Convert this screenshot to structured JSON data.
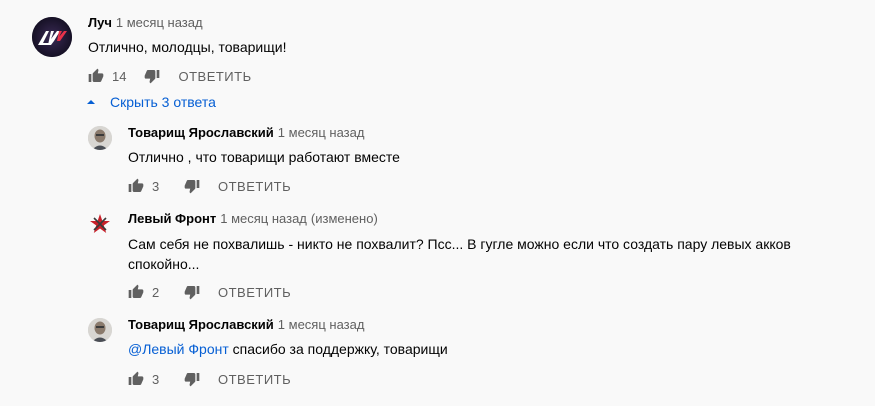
{
  "comments": [
    {
      "author": "Луч",
      "time": "1 месяц назад",
      "text": "Отлично, молодцы, товарищи!",
      "likes": "14",
      "reply_label": "ОТВЕТИТЬ"
    }
  ],
  "replies_toggle": {
    "label": "Скрыть 3 ответа"
  },
  "replies": [
    {
      "author": "Товарищ Ярославский",
      "time": "1 месяц назад",
      "text": "Отлично , что товарищи работают вместе",
      "likes": "3",
      "reply_label": "ОТВЕТИТЬ"
    },
    {
      "author": "Левый Фронт",
      "time": "1 месяц назад",
      "edited": "(изменено)",
      "text_line1": "Сам себя не похвалишь - никто не похвалит? Псс... В гугле можно если что создать пару левых акков",
      "text_line2": "спокойно...",
      "likes": "2",
      "reply_label": "ОТВЕТИТЬ"
    },
    {
      "author": "Товарищ Ярославский",
      "time": "1 месяц назад",
      "mention": "@Левый Фронт",
      "text": " спасибо за поддержку, товарищи",
      "likes": "3",
      "reply_label": "ОТВЕТИТЬ"
    }
  ],
  "colors": {
    "link": "#065fd4",
    "meta": "#606060",
    "background": "#f9f9f9"
  }
}
